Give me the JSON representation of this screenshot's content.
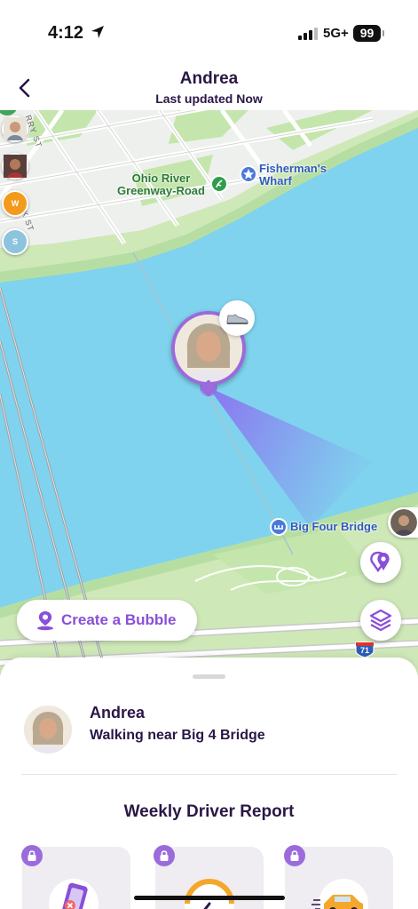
{
  "status_bar": {
    "time": "4:12",
    "network": "5G+",
    "battery": "99"
  },
  "header": {
    "title": "Andrea",
    "subtitle": "Last updated Now"
  },
  "map": {
    "labels": {
      "park": "Ohio River\nGreenway-Road",
      "poi_wharf": "Fisherman's\nWharf",
      "poi_bridge": "Big Four Bridge",
      "street_1": "RRY ST",
      "street_2": "K ST",
      "highway": "71"
    },
    "side_avatars": [
      {
        "initial": "",
        "color": "#c9b9a6"
      },
      {
        "initial": "",
        "color": "#6b4a3a"
      },
      {
        "initial": "W",
        "color": "#f39a1c"
      },
      {
        "initial": "S",
        "color": "#8cc4de"
      }
    ],
    "create_bubble_label": "Create a Bubble"
  },
  "sheet": {
    "member_name": "Andrea",
    "member_status": "Walking near Big 4 Bridge",
    "report_title": "Weekly Driver Report"
  },
  "colors": {
    "accent": "#9b6bdc",
    "water": "#7fd3ee",
    "land": "#cfe8b8",
    "text": "#2a1746"
  }
}
